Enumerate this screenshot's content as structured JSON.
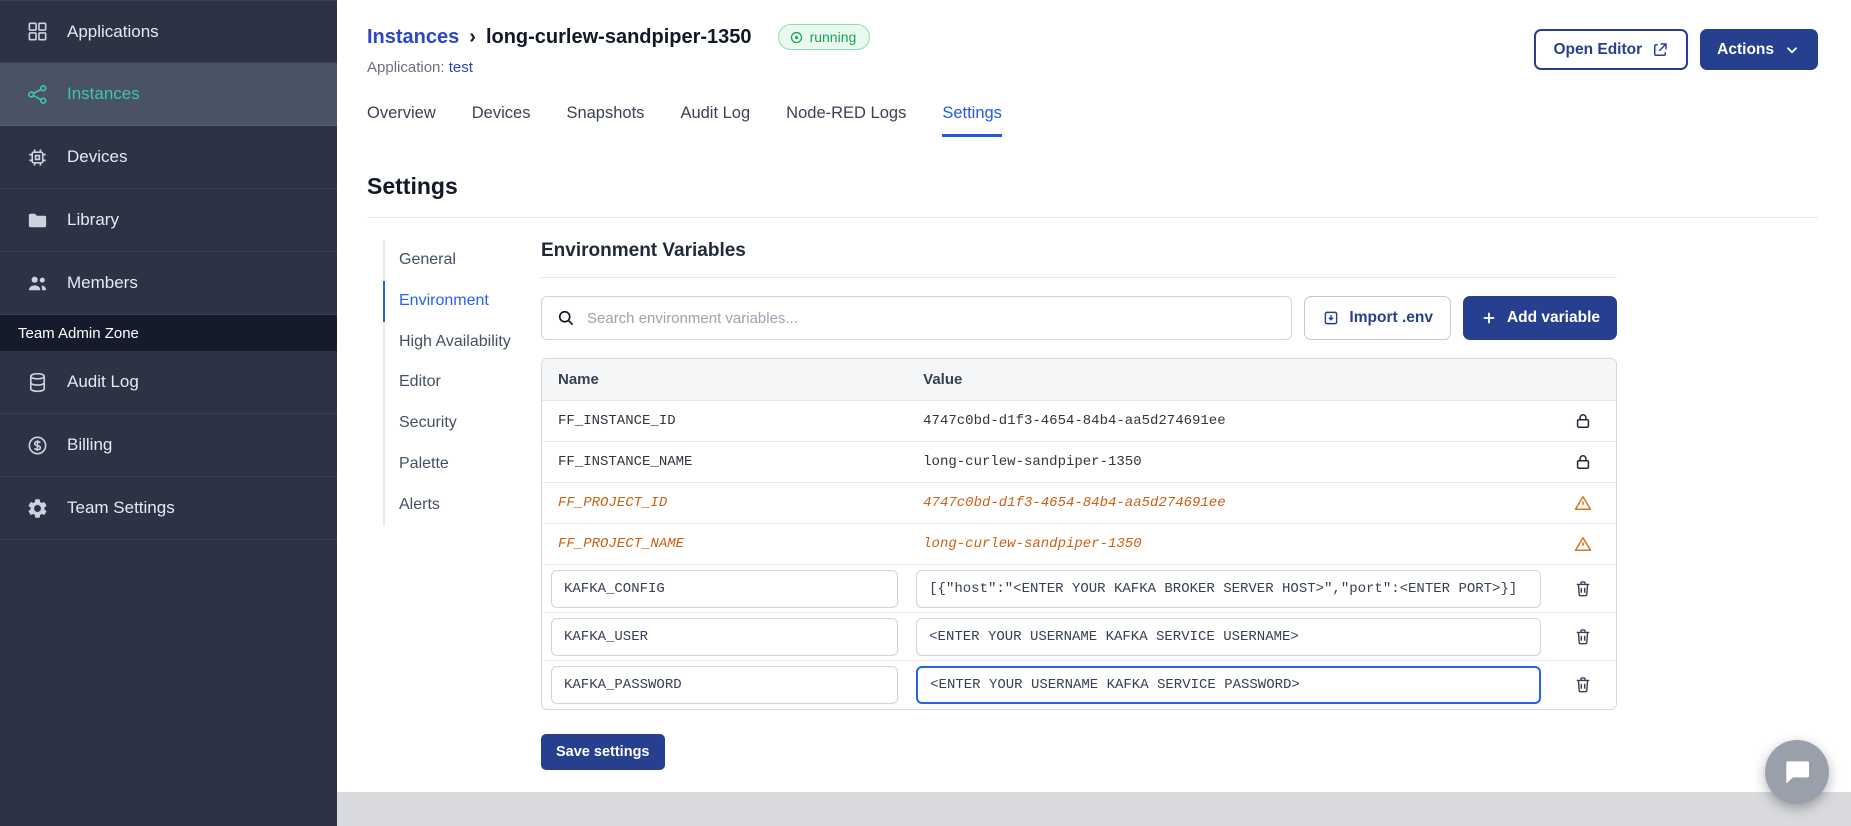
{
  "sidebar": {
    "items": [
      {
        "label": "Applications"
      },
      {
        "label": "Instances"
      },
      {
        "label": "Devices"
      },
      {
        "label": "Library"
      },
      {
        "label": "Members"
      }
    ],
    "section_label": "Team Admin Zone",
    "admin_items": [
      {
        "label": "Audit Log"
      },
      {
        "label": "Billing"
      },
      {
        "label": "Team Settings"
      }
    ]
  },
  "header": {
    "breadcrumb_root": "Instances",
    "breadcrumb_separator": "›",
    "instance_name": "long-curlew-sandpiper-1350",
    "status_label": "running",
    "application_label": "Application:",
    "application_name": "test",
    "open_editor_label": "Open Editor",
    "actions_label": "Actions"
  },
  "tabs": [
    "Overview",
    "Devices",
    "Snapshots",
    "Audit Log",
    "Node-RED Logs",
    "Settings"
  ],
  "settings": {
    "title": "Settings",
    "subnav": [
      "General",
      "Environment",
      "High Availability",
      "Editor",
      "Security",
      "Palette",
      "Alerts"
    ],
    "panel_title": "Environment Variables",
    "search_placeholder": "Search environment variables...",
    "import_label": "Import .env",
    "add_label": "Add variable",
    "save_label": "Save settings",
    "table": {
      "columns": [
        "Name",
        "Value"
      ],
      "rows": [
        {
          "name": "FF_INSTANCE_ID",
          "value": "4747c0bd-d1f3-4654-84b4-aa5d274691ee",
          "type": "locked"
        },
        {
          "name": "FF_INSTANCE_NAME",
          "value": "long-curlew-sandpiper-1350",
          "type": "locked"
        },
        {
          "name": "FF_PROJECT_ID",
          "value": "4747c0bd-d1f3-4654-84b4-aa5d274691ee",
          "type": "deprecated"
        },
        {
          "name": "FF_PROJECT_NAME",
          "value": "long-curlew-sandpiper-1350",
          "type": "deprecated"
        },
        {
          "name": "KAFKA_CONFIG",
          "value": "[{\"host\":\"<ENTER YOUR KAFKA BROKER SERVER HOST>\",\"port\":<ENTER PORT>}]",
          "type": "editable"
        },
        {
          "name": "KAFKA_USER",
          "value": "<ENTER YOUR USERNAME KAFKA SERVICE USERNAME>",
          "type": "editable"
        },
        {
          "name": "KAFKA_PASSWORD",
          "value": "<ENTER YOUR USERNAME KAFKA SERVICE PASSWORD>",
          "type": "editable",
          "focused": true
        }
      ]
    }
  },
  "colors": {
    "accent_blue": "#2563eb",
    "link_blue": "#2b46c8",
    "button_indigo": "#26408f",
    "sidebar_teal": "#40c4b4",
    "success_green": "#18a457",
    "warning_orange": "#cb6015"
  }
}
